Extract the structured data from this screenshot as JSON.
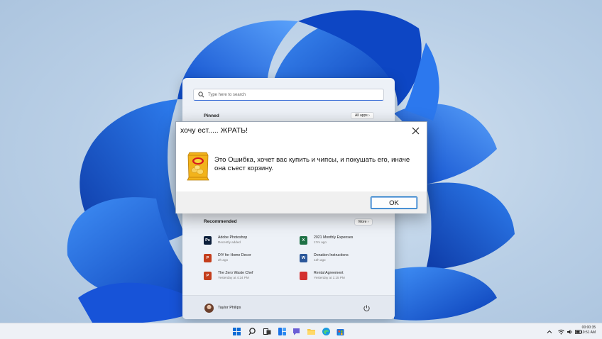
{
  "start_menu": {
    "search_placeholder": "Type here to search",
    "pinned_label": "Pinned",
    "all_apps_label": "All apps ›",
    "recommended_label": "Recommended",
    "more_label": "More ›",
    "recommended": [
      {
        "title": "Adobe Photoshop",
        "subtitle": "Recently added",
        "icon": "photoshop-icon",
        "icon_text": "Ps",
        "color": "#0b1e3a"
      },
      {
        "title": "2021 Monthly Expenses",
        "subtitle": "17m ago",
        "icon": "excel-icon",
        "icon_text": "X",
        "color": "#1e7145"
      },
      {
        "title": "DIY for Home Decor",
        "subtitle": "2h ago",
        "icon": "powerpoint-icon",
        "icon_text": "P",
        "color": "#c43e1c"
      },
      {
        "title": "Donation Instructions",
        "subtitle": "12h ago",
        "icon": "word-icon",
        "icon_text": "W",
        "color": "#2b579a"
      },
      {
        "title": "The Zero Waste Chef",
        "subtitle": "Yesterday at 4:24 PM",
        "icon": "powerpoint-icon",
        "icon_text": "P",
        "color": "#c43e1c"
      },
      {
        "title": "Rental Agreement",
        "subtitle": "Yesterday at 1:15 PM",
        "icon": "pdf-icon",
        "icon_text": "",
        "color": "#d32f2f"
      }
    ],
    "user_name": "Taylor Philips"
  },
  "dialog": {
    "title": "хочу ест..... ЖРАТЬ!",
    "message": "Это Ошибка, хочет вас купить и чипсы, и покушать его, иначе она съест корзину.",
    "ok_label": "OK",
    "icon": "chips-bag-icon"
  },
  "taskbar": {
    "icons": [
      "windows-start-icon",
      "search-icon",
      "task-view-icon",
      "widgets-icon",
      "chat-icon",
      "file-explorer-icon",
      "edge-icon",
      "store-icon"
    ],
    "time": "00:00:35",
    "date": "10:51 AM"
  },
  "colors": {
    "accent": "#0067c0",
    "wallpaper_bloom": "#1565e0"
  }
}
